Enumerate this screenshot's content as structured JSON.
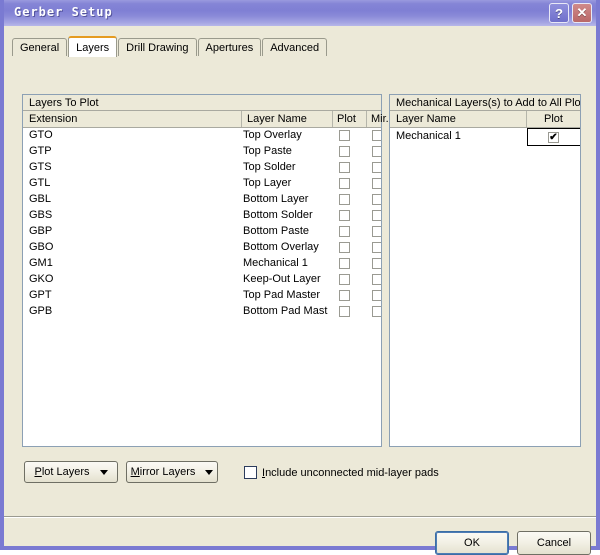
{
  "window": {
    "title": "Gerber Setup",
    "help_button": "?",
    "close_button": "✕"
  },
  "tabs": [
    {
      "label": "General",
      "active": false
    },
    {
      "label": "Layers",
      "active": true
    },
    {
      "label": "Drill Drawing",
      "active": false
    },
    {
      "label": "Apertures",
      "active": false
    },
    {
      "label": "Advanced",
      "active": false
    }
  ],
  "layers_panel": {
    "title": "Layers To Plot",
    "columns": [
      "Extension",
      "Layer Name",
      "Plot",
      "Mir..."
    ],
    "rows": [
      {
        "extension": "GTO",
        "name": "Top Overlay",
        "plot": false,
        "mirror": false
      },
      {
        "extension": "GTP",
        "name": "Top Paste",
        "plot": false,
        "mirror": false
      },
      {
        "extension": "GTS",
        "name": "Top Solder",
        "plot": false,
        "mirror": false
      },
      {
        "extension": "GTL",
        "name": "Top Layer",
        "plot": false,
        "mirror": false
      },
      {
        "extension": "GBL",
        "name": "Bottom Layer",
        "plot": false,
        "mirror": false
      },
      {
        "extension": "GBS",
        "name": "Bottom Solder",
        "plot": false,
        "mirror": false
      },
      {
        "extension": "GBP",
        "name": "Bottom Paste",
        "plot": false,
        "mirror": false
      },
      {
        "extension": "GBO",
        "name": "Bottom Overlay",
        "plot": false,
        "mirror": false
      },
      {
        "extension": "GM1",
        "name": "Mechanical 1",
        "plot": false,
        "mirror": false
      },
      {
        "extension": "GKO",
        "name": "Keep-Out Layer",
        "plot": false,
        "mirror": false
      },
      {
        "extension": "GPT",
        "name": "Top Pad Master",
        "plot": false,
        "mirror": false
      },
      {
        "extension": "GPB",
        "name": "Bottom Pad Mast",
        "plot": false,
        "mirror": false
      }
    ]
  },
  "mechanical_panel": {
    "title": "Mechanical Layers(s) to Add to All Plots",
    "columns": [
      "Layer Name",
      "Plot"
    ],
    "rows": [
      {
        "name": "Mechanical 1",
        "plot": true,
        "check_glyph": "✔",
        "selected": true
      }
    ]
  },
  "bottom": {
    "plot_layers_button": {
      "accel": "P",
      "rest": "lot Layers"
    },
    "mirror_layers_button": {
      "accel": "M",
      "rest": "irror Layers"
    },
    "include_checkbox": {
      "accel": "I",
      "rest": "nclude unconnected mid-layer pads",
      "checked": false
    }
  },
  "footer": {
    "ok_label": "OK",
    "cancel_label": "Cancel"
  },
  "colors": {
    "frame": "#7a7ad2",
    "client": "#ece9d8",
    "active_tab_accent": "#e59b20",
    "panel_border": "#8ca0b4",
    "focus_blue": "#3b6ea5"
  }
}
